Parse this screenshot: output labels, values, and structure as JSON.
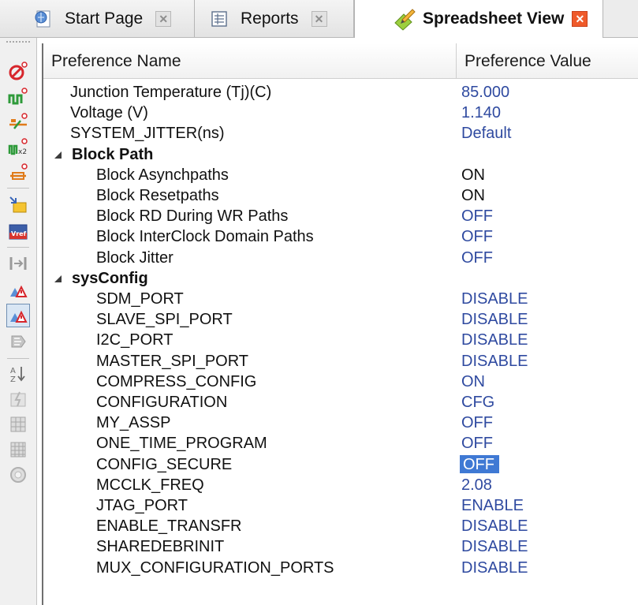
{
  "tabs": [
    {
      "label": "Start Page",
      "icon": "start-page-icon",
      "active": false
    },
    {
      "label": "Reports",
      "icon": "reports-icon",
      "active": false
    },
    {
      "label": "Spreadsheet View",
      "icon": "spreadsheet-pencil-icon",
      "active": true
    }
  ],
  "grid": {
    "headers": {
      "name": "Preference Name",
      "value": "Preference Value"
    },
    "rows": [
      {
        "name": "Junction Temperature (Tj)(C)",
        "value": "85.000",
        "color": "blue"
      },
      {
        "name": "Voltage (V)",
        "value": "1.140",
        "color": "blue"
      },
      {
        "name": "SYSTEM_JITTER(ns)",
        "value": "Default",
        "color": "blue"
      },
      {
        "group": "Block Path"
      },
      {
        "name": "Block Asynchpaths",
        "value": "ON",
        "color": "black"
      },
      {
        "name": "Block Resetpaths",
        "value": "ON",
        "color": "black"
      },
      {
        "name": "Block RD During WR Paths",
        "value": "OFF",
        "color": "blue"
      },
      {
        "name": "Block InterClock Domain Paths",
        "value": "OFF",
        "color": "blue"
      },
      {
        "name": "Block Jitter",
        "value": "OFF",
        "color": "blue"
      },
      {
        "group": "sysConfig"
      },
      {
        "name": "SDM_PORT",
        "value": "DISABLE",
        "color": "blue"
      },
      {
        "name": "SLAVE_SPI_PORT",
        "value": "DISABLE",
        "color": "blue"
      },
      {
        "name": "I2C_PORT",
        "value": "DISABLE",
        "color": "blue"
      },
      {
        "name": "MASTER_SPI_PORT",
        "value": "DISABLE",
        "color": "blue"
      },
      {
        "name": "COMPRESS_CONFIG",
        "value": "ON",
        "color": "blue"
      },
      {
        "name": "CONFIGURATION",
        "value": "CFG",
        "color": "blue"
      },
      {
        "name": "MY_ASSP",
        "value": "OFF",
        "color": "blue"
      },
      {
        "name": "ONE_TIME_PROGRAM",
        "value": "OFF",
        "color": "blue"
      },
      {
        "name": "CONFIG_SECURE",
        "value": "OFF",
        "color": "selected"
      },
      {
        "name": "MCCLK_FREQ",
        "value": "2.08",
        "color": "blue"
      },
      {
        "name": "JTAG_PORT",
        "value": "ENABLE",
        "color": "blue"
      },
      {
        "name": "ENABLE_TRANSFR",
        "value": "DISABLE",
        "color": "blue"
      },
      {
        "name": "SHAREDEBRINIT",
        "value": "DISABLE",
        "color": "blue"
      },
      {
        "name": "MUX_CONFIGURATION_PORTS",
        "value": "DISABLE",
        "color": "blue"
      }
    ]
  },
  "toolbar": [
    "clock-no-icon",
    "pulse-wave-icon",
    "clock-path-icon",
    "multicycle-wave-icon",
    "clock-skew-icon",
    "import-icon",
    "vref-icon",
    "block-icon",
    "warning-triangle-icon",
    "warning-triangle-pressed-icon",
    "chip-icon",
    "sort-az-icon",
    "lightning-disabled-icon",
    "grid-disabled-icon",
    "grid2-disabled-icon",
    "circle-disabled-icon"
  ],
  "colors": {
    "value_blue": "#2f4aa0",
    "selection": "#3f79d4",
    "close_active": "#ef5a2a"
  }
}
